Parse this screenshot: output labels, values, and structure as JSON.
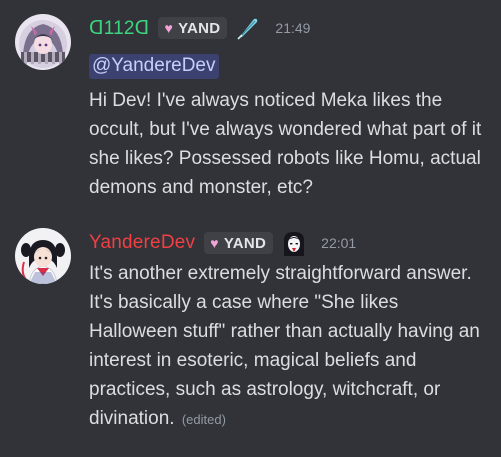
{
  "messages": [
    {
      "username": "ᗡ112ᗡ",
      "tag": "YAND",
      "role_icon": "feather-quill-icon",
      "timestamp": "21:49",
      "mention": "@YandereDev",
      "text": "Hi Dev! I've always noticed Meka likes the occult, but I've always wondered what part of it she likes? Possessed robots like Homu, actual demons and monster, etc?",
      "username_color": "#3ed37f"
    },
    {
      "username": "YandereDev",
      "tag": "YAND",
      "role_icon": "anime-girl-portrait-icon",
      "timestamp": "22:01",
      "text": "It's another extremely straightforward answer. It's basically a case where \"She likes Halloween stuff\" rather than actually having an interest in esoteric, magical beliefs and practices, such as astrology, witchcraft, or divination.",
      "edited": "(edited)",
      "username_color": "#f23f43"
    }
  ],
  "colors": {
    "background": "#313338",
    "mention_bg": "#3c4270",
    "muted": "#949ba4"
  }
}
